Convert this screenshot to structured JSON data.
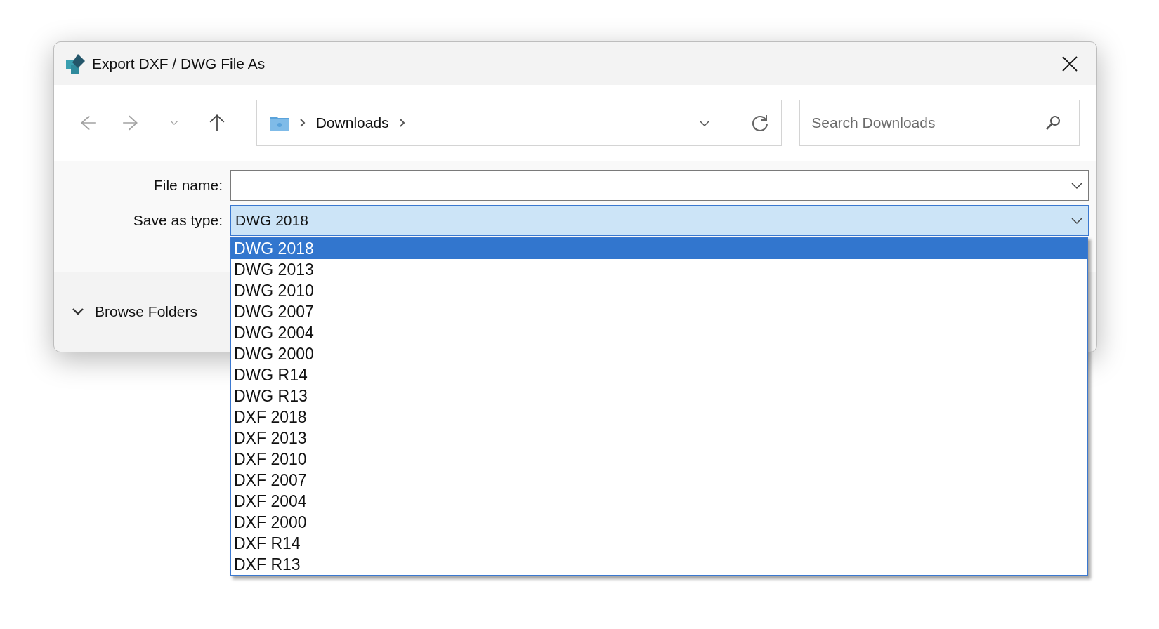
{
  "window": {
    "title": "Export DXF / DWG File As"
  },
  "nav_buttons": [
    {
      "kind": "back",
      "disabled": true
    },
    {
      "kind": "forward",
      "disabled": true
    },
    {
      "kind": "recent",
      "disabled": true
    },
    {
      "kind": "up",
      "disabled": false
    }
  ],
  "address_bar": {
    "path": [
      "Downloads"
    ]
  },
  "search": {
    "placeholder": "Search Downloads"
  },
  "file_name": {
    "label": "File name:"
  },
  "save_as_type": {
    "label": "Save as type:",
    "value": "DWG 2018",
    "expanded": true,
    "options": [
      {
        "label": "DWG 2018",
        "selected": true
      },
      {
        "label": "DWG 2013",
        "selected": false
      },
      {
        "label": "DWG 2010",
        "selected": false
      },
      {
        "label": "DWG 2007",
        "selected": false
      },
      {
        "label": "DWG 2004",
        "selected": false
      },
      {
        "label": "DWG 2000",
        "selected": false
      },
      {
        "label": "DWG R14",
        "selected": false
      },
      {
        "label": "DWG R13",
        "selected": false
      },
      {
        "label": "DXF 2018",
        "selected": false
      },
      {
        "label": "DXF 2013",
        "selected": false
      },
      {
        "label": "DXF 2010",
        "selected": false
      },
      {
        "label": "DXF 2007",
        "selected": false
      },
      {
        "label": "DXF 2004",
        "selected": false
      },
      {
        "label": "DXF 2000",
        "selected": false
      },
      {
        "label": "DXF R14",
        "selected": false
      },
      {
        "label": "DXF R13",
        "selected": false
      }
    ]
  },
  "browse_folders": {
    "label": "Browse Folders",
    "expanded": false
  }
}
